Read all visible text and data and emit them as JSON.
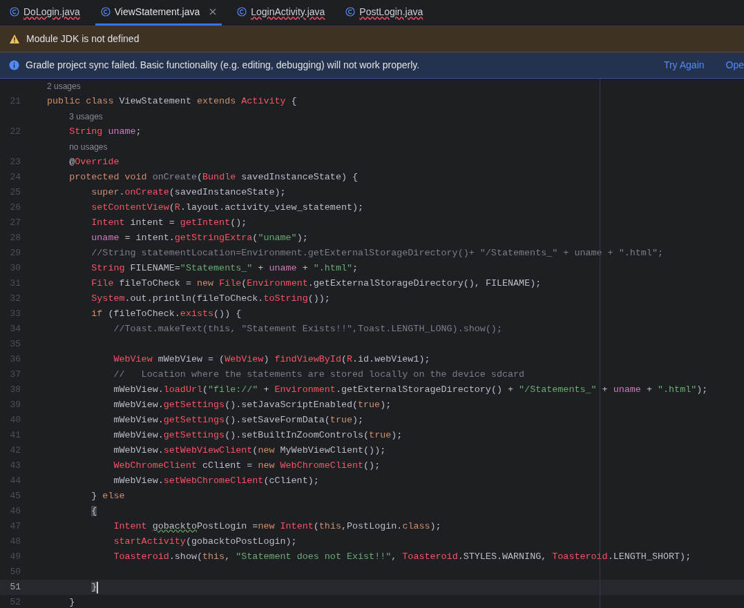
{
  "tabs": [
    {
      "label": "DoLogin.java",
      "selected": false,
      "error": true,
      "closable": false
    },
    {
      "label": "ViewStatement.java",
      "selected": true,
      "error": false,
      "closable": true
    },
    {
      "label": "LoginActivity.java",
      "selected": false,
      "error": true,
      "closable": false
    },
    {
      "label": "PostLogin.java",
      "selected": false,
      "error": true,
      "closable": false
    }
  ],
  "banners": [
    {
      "kind": "warning",
      "text": "Module JDK is not defined"
    },
    {
      "kind": "info",
      "text": "Gradle project sync failed. Basic functionality (e.g. editing, debugging) will not work properly.",
      "actions": [
        "Try Again",
        "Ope"
      ]
    }
  ],
  "editor": {
    "lines": [
      {
        "kind": "hint",
        "text": "2 usages"
      },
      {
        "kind": "code",
        "number": "21",
        "current": false,
        "tokens": [
          {
            "kind": "kw",
            "text": "public class "
          },
          {
            "kind": "plain",
            "text": "ViewStatement "
          },
          {
            "kind": "kw",
            "text": "extends "
          },
          {
            "kind": "err",
            "text": "Activity"
          },
          {
            "kind": "plain",
            "text": " {"
          }
        ]
      },
      {
        "kind": "hint",
        "text": "3 usages"
      },
      {
        "kind": "code",
        "number": "22",
        "current": false,
        "tokens": [
          {
            "kind": "err",
            "text": "    String"
          },
          {
            "kind": "field",
            "text": " uname"
          },
          {
            "kind": "plain",
            "text": ";"
          }
        ]
      },
      {
        "kind": "hint",
        "text": "no usages"
      },
      {
        "kind": "code",
        "number": "23",
        "current": false,
        "tokens": [
          {
            "kind": "plain",
            "text": "    @"
          },
          {
            "kind": "err",
            "text": "Override"
          }
        ]
      },
      {
        "kind": "code",
        "number": "24",
        "current": false,
        "tokens": [
          {
            "kind": "kw",
            "text": "    protected void "
          },
          {
            "kind": "dim",
            "text": "onCreate"
          },
          {
            "kind": "plain",
            "text": "("
          },
          {
            "kind": "err",
            "text": "Bundle"
          },
          {
            "kind": "plain",
            "text": " savedInstanceState) {"
          }
        ]
      },
      {
        "kind": "code",
        "number": "25",
        "current": false,
        "tokens": [
          {
            "kind": "kw",
            "text": "        super"
          },
          {
            "kind": "plain",
            "text": "."
          },
          {
            "kind": "err",
            "text": "onCreate"
          },
          {
            "kind": "plain",
            "text": "(savedInstanceState);"
          }
        ]
      },
      {
        "kind": "code",
        "number": "26",
        "current": false,
        "tokens": [
          {
            "kind": "err",
            "text": "        setContentView"
          },
          {
            "kind": "plain",
            "text": "("
          },
          {
            "kind": "err",
            "text": "R"
          },
          {
            "kind": "plain",
            "text": ".layout.activity_view_statement);"
          }
        ]
      },
      {
        "kind": "code",
        "number": "27",
        "current": false,
        "tokens": [
          {
            "kind": "err",
            "text": "        Intent"
          },
          {
            "kind": "plain",
            "text": " intent = "
          },
          {
            "kind": "err",
            "text": "getIntent"
          },
          {
            "kind": "plain",
            "text": "();"
          }
        ]
      },
      {
        "kind": "code",
        "number": "28",
        "current": false,
        "tokens": [
          {
            "kind": "field",
            "text": "        uname"
          },
          {
            "kind": "plain",
            "text": " = intent."
          },
          {
            "kind": "err",
            "text": "getStringExtra"
          },
          {
            "kind": "plain",
            "text": "("
          },
          {
            "kind": "str",
            "text": "\"uname\""
          },
          {
            "kind": "plain",
            "text": ");"
          }
        ]
      },
      {
        "kind": "code",
        "number": "29",
        "current": false,
        "tokens": [
          {
            "kind": "cmt",
            "text": "        //String statementLocation=Environment.getExternalStorageDirectory()+ \"/Statements_\" + uname + \".html\";"
          }
        ]
      },
      {
        "kind": "code",
        "number": "30",
        "current": false,
        "tokens": [
          {
            "kind": "err",
            "text": "        String"
          },
          {
            "kind": "plain",
            "text": " FILENAME="
          },
          {
            "kind": "str",
            "text": "\"Statements_\""
          },
          {
            "kind": "plain",
            "text": " + "
          },
          {
            "kind": "field",
            "text": "uname"
          },
          {
            "kind": "plain",
            "text": " + "
          },
          {
            "kind": "str",
            "text": "\".html\""
          },
          {
            "kind": "plain",
            "text": ";"
          }
        ]
      },
      {
        "kind": "code",
        "number": "31",
        "current": false,
        "tokens": [
          {
            "kind": "err",
            "text": "        File"
          },
          {
            "kind": "plain",
            "text": " fileToCheck = "
          },
          {
            "kind": "kw",
            "text": "new "
          },
          {
            "kind": "err",
            "text": "File"
          },
          {
            "kind": "plain",
            "text": "("
          },
          {
            "kind": "err",
            "text": "Environment"
          },
          {
            "kind": "plain",
            "text": ".getExternalStorageDirectory(), FILENAME);"
          }
        ]
      },
      {
        "kind": "code",
        "number": "32",
        "current": false,
        "tokens": [
          {
            "kind": "err",
            "text": "        System"
          },
          {
            "kind": "plain",
            "text": ".out.println(fileToCheck."
          },
          {
            "kind": "err",
            "text": "toString"
          },
          {
            "kind": "plain",
            "text": "());"
          }
        ]
      },
      {
        "kind": "code",
        "number": "33",
        "current": false,
        "tokens": [
          {
            "kind": "kw",
            "text": "        if"
          },
          {
            "kind": "plain",
            "text": " (fileToCheck."
          },
          {
            "kind": "err",
            "text": "exists"
          },
          {
            "kind": "plain",
            "text": "()) {"
          }
        ]
      },
      {
        "kind": "code",
        "number": "34",
        "current": false,
        "tokens": [
          {
            "kind": "cmt",
            "text": "            //Toast.makeText(this, \"Statement Exists!!\",Toast.LENGTH_LONG).show();"
          }
        ]
      },
      {
        "kind": "code",
        "number": "35",
        "current": false
      },
      {
        "kind": "code",
        "number": "36",
        "current": false,
        "tokens": [
          {
            "kind": "err",
            "text": "            WebView"
          },
          {
            "kind": "plain",
            "text": " mWebView = ("
          },
          {
            "kind": "err",
            "text": "WebView"
          },
          {
            "kind": "plain",
            "text": ") "
          },
          {
            "kind": "err",
            "text": "findViewById"
          },
          {
            "kind": "plain",
            "text": "("
          },
          {
            "kind": "err",
            "text": "R"
          },
          {
            "kind": "plain",
            "text": ".id.webView1);"
          }
        ]
      },
      {
        "kind": "code",
        "number": "37",
        "current": false,
        "tokens": [
          {
            "kind": "cmt",
            "text": "            //   Location where the statements are stored locally on the device sdcard"
          }
        ]
      },
      {
        "kind": "code",
        "number": "38",
        "current": false,
        "tokens": [
          {
            "kind": "plain",
            "text": "            mWebView."
          },
          {
            "kind": "err",
            "text": "loadUrl"
          },
          {
            "kind": "plain",
            "text": "("
          },
          {
            "kind": "str",
            "text": "\"file://\""
          },
          {
            "kind": "plain",
            "text": " + "
          },
          {
            "kind": "err",
            "text": "Environment"
          },
          {
            "kind": "plain",
            "text": ".getExternalStorageDirectory() + "
          },
          {
            "kind": "str",
            "text": "\"/Statements_\""
          },
          {
            "kind": "plain",
            "text": " + "
          },
          {
            "kind": "field",
            "text": "uname"
          },
          {
            "kind": "plain",
            "text": " + "
          },
          {
            "kind": "str",
            "text": "\".html\""
          },
          {
            "kind": "plain",
            "text": ");"
          }
        ]
      },
      {
        "kind": "code",
        "number": "39",
        "current": false,
        "tokens": [
          {
            "kind": "plain",
            "text": "            mWebView."
          },
          {
            "kind": "err",
            "text": "getSettings"
          },
          {
            "kind": "plain",
            "text": "().setJavaScriptEnabled("
          },
          {
            "kind": "kw",
            "text": "true"
          },
          {
            "kind": "plain",
            "text": ");"
          }
        ]
      },
      {
        "kind": "code",
        "number": "40",
        "current": false,
        "tokens": [
          {
            "kind": "plain",
            "text": "            mWebView."
          },
          {
            "kind": "err",
            "text": "getSettings"
          },
          {
            "kind": "plain",
            "text": "().setSaveFormData("
          },
          {
            "kind": "kw",
            "text": "true"
          },
          {
            "kind": "plain",
            "text": ");"
          }
        ]
      },
      {
        "kind": "code",
        "number": "41",
        "current": false,
        "tokens": [
          {
            "kind": "plain",
            "text": "            mWebView."
          },
          {
            "kind": "err",
            "text": "getSettings"
          },
          {
            "kind": "plain",
            "text": "().setBuiltInZoomControls("
          },
          {
            "kind": "kw",
            "text": "true"
          },
          {
            "kind": "plain",
            "text": ");"
          }
        ]
      },
      {
        "kind": "code",
        "number": "42",
        "current": false,
        "tokens": [
          {
            "kind": "plain",
            "text": "            mWebView."
          },
          {
            "kind": "err",
            "text": "setWebViewClient"
          },
          {
            "kind": "plain",
            "text": "("
          },
          {
            "kind": "kw",
            "text": "new "
          },
          {
            "kind": "plain",
            "text": "MyWebViewClient());"
          }
        ]
      },
      {
        "kind": "code",
        "number": "43",
        "current": false,
        "tokens": [
          {
            "kind": "err",
            "text": "            WebChromeClient"
          },
          {
            "kind": "plain",
            "text": " cClient = "
          },
          {
            "kind": "kw",
            "text": "new "
          },
          {
            "kind": "err",
            "text": "WebChromeClient"
          },
          {
            "kind": "plain",
            "text": "();"
          }
        ]
      },
      {
        "kind": "code",
        "number": "44",
        "current": false,
        "tokens": [
          {
            "kind": "plain",
            "text": "            mWebView."
          },
          {
            "kind": "err",
            "text": "setWebChromeClient"
          },
          {
            "kind": "plain",
            "text": "(cClient);"
          }
        ]
      },
      {
        "kind": "code",
        "number": "45",
        "current": false,
        "tokens": [
          {
            "kind": "plain",
            "text": "        } "
          },
          {
            "kind": "kw",
            "text": "else"
          }
        ]
      },
      {
        "kind": "code",
        "number": "46",
        "current": false,
        "tokens": [
          {
            "kind": "match",
            "text": "        {"
          }
        ]
      },
      {
        "kind": "code",
        "number": "47",
        "current": false,
        "tokens": [
          {
            "kind": "err",
            "text": "            Intent "
          },
          {
            "kind": "typo",
            "text": "gobackto"
          },
          {
            "kind": "plain",
            "text": "PostLogin ="
          },
          {
            "kind": "kw",
            "text": "new "
          },
          {
            "kind": "err",
            "text": "Intent"
          },
          {
            "kind": "plain",
            "text": "("
          },
          {
            "kind": "kw",
            "text": "this"
          },
          {
            "kind": "plain",
            "text": ",PostLogin."
          },
          {
            "kind": "kw",
            "text": "class"
          },
          {
            "kind": "plain",
            "text": ");"
          }
        ]
      },
      {
        "kind": "code",
        "number": "48",
        "current": false,
        "tokens": [
          {
            "kind": "err",
            "text": "            startActivity"
          },
          {
            "kind": "plain",
            "text": "(gobacktoPostLogin);"
          }
        ]
      },
      {
        "kind": "code",
        "number": "49",
        "current": false,
        "tokens": [
          {
            "kind": "err",
            "text": "            Toasteroid"
          },
          {
            "kind": "plain",
            "text": ".show("
          },
          {
            "kind": "kw",
            "text": "this"
          },
          {
            "kind": "plain",
            "text": ", "
          },
          {
            "kind": "str",
            "text": "\"Statement does not Exist!!\""
          },
          {
            "kind": "plain",
            "text": ", "
          },
          {
            "kind": "err",
            "text": "Toasteroid"
          },
          {
            "kind": "plain",
            "text": ".STYLES.WARNING, "
          },
          {
            "kind": "err",
            "text": "Toasteroid"
          },
          {
            "kind": "plain",
            "text": ".LENGTH_SHORT);"
          }
        ]
      },
      {
        "kind": "code",
        "number": "50",
        "current": false
      },
      {
        "kind": "code",
        "number": "51",
        "current": true,
        "tokens": [
          {
            "kind": "match",
            "text": "        }"
          }
        ]
      },
      {
        "kind": "code",
        "number": "52",
        "current": false,
        "tokens": [
          {
            "kind": "plain",
            "text": "    }"
          }
        ]
      }
    ]
  }
}
